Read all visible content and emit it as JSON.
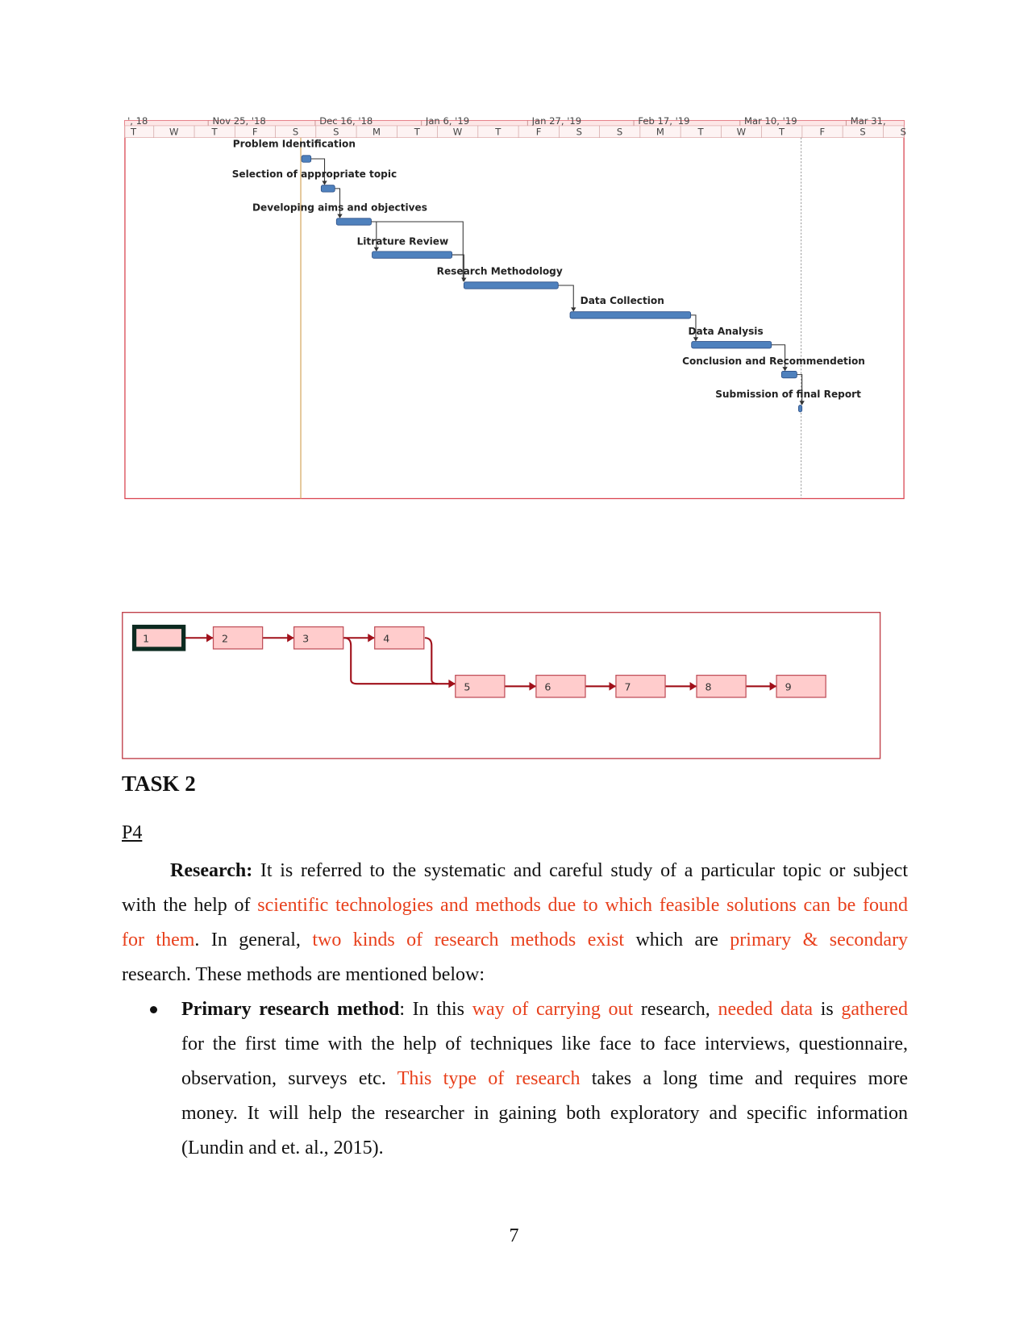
{
  "gantt": {
    "months": [
      "', 18",
      "Nov 25, '18",
      "Dec 16, '18",
      "Jan 6, '19",
      "Jan 27, '19",
      "Feb 17, '19",
      "Mar 10, '19",
      "Mar 31,"
    ],
    "days": [
      "T",
      "W",
      "T",
      "F",
      "S",
      "S",
      "M",
      "T",
      "W",
      "T",
      "F",
      "S",
      "S",
      "M",
      "T",
      "W",
      "T",
      "F",
      "S",
      "S"
    ],
    "tasks": [
      {
        "label": "Problem Identification"
      },
      {
        "label": "Selection of appropriate topic"
      },
      {
        "label": "Developing aims and objectives"
      },
      {
        "label": "Litrature Review"
      },
      {
        "label": "Research Methodology"
      },
      {
        "label": "Data Collection"
      },
      {
        "label": "Data Analysis"
      },
      {
        "label": "Conclusion and Recommendetion"
      },
      {
        "label": "Submission of final Report"
      }
    ],
    "bar_color": "#4f81bd"
  },
  "network": {
    "nodes": [
      "1",
      "2",
      "3",
      "4",
      "5",
      "6",
      "7",
      "8",
      "9"
    ],
    "node_fill": "#ffcccc",
    "link_color": "#a0101a"
  },
  "heading": "TASK 2",
  "subheading": "P4",
  "paragraph": {
    "l1_bold": "Research:",
    "l1": "It is referred to the systematic and careful study of a particular topic or subject",
    "l2a": "with the help of",
    "l2b": "scientific technologies and methods due to which feasible solutions can be found",
    "l3a": "for them",
    "l3b": ". In general,",
    "l3c": "two kinds of research methods exist",
    "l3d": "which are",
    "l3e": "primary & secondary",
    "l4": "research. These methods are mentioned below:"
  },
  "bullet": {
    "bold": "Primary research method",
    "a": ": In this ",
    "b": "way of carrying out",
    "c": "research,",
    "d": "needed data",
    "e": "is",
    "f": "gathered",
    "l2": "for the first time with the help of techniques like face to face interviews, questionnaire,",
    "l3a": "observation, surveys etc.",
    "l3b": "This type of research",
    "l3c": "takes a long time and requires more",
    "l4": "money. It will help the researcher in gaining both exploratory and specific information",
    "l5": "(Lundin and et. al., 2015)."
  },
  "page_number": "7"
}
